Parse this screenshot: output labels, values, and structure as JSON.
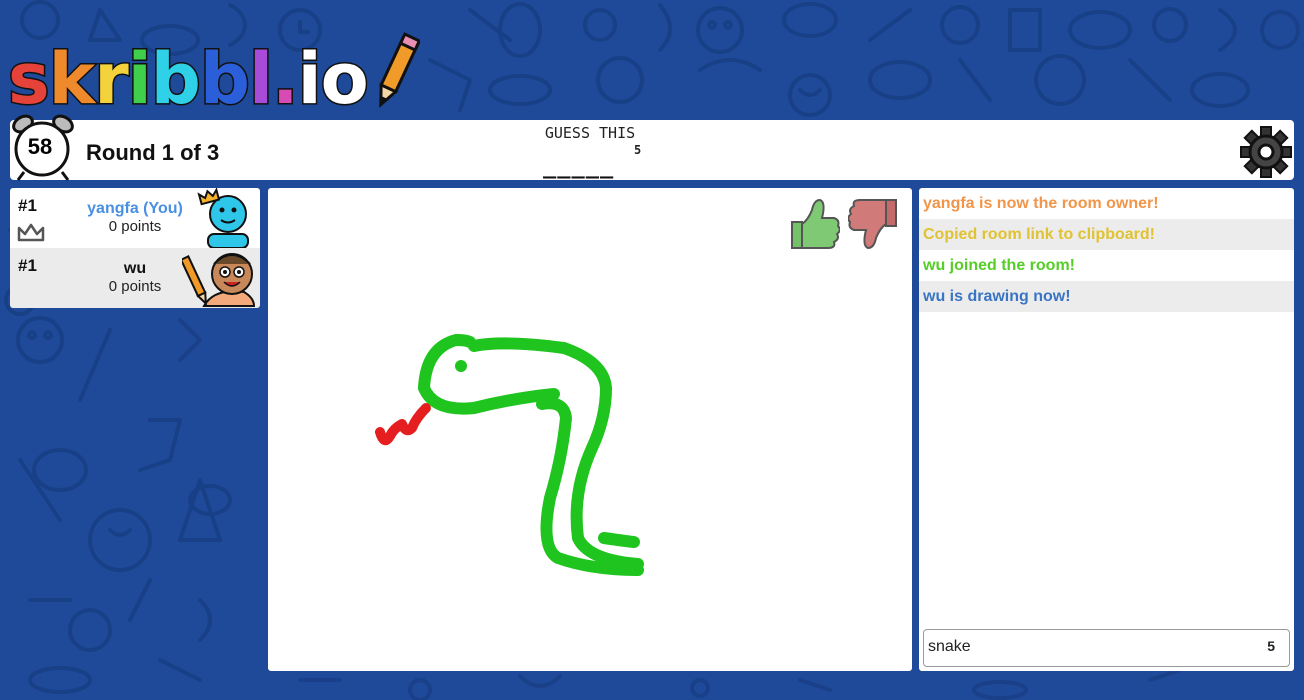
{
  "logo": {
    "letters": [
      {
        "char": "s",
        "color": "#e5433a"
      },
      {
        "char": "k",
        "color": "#ef8a2c"
      },
      {
        "char": "r",
        "color": "#f4d23b"
      },
      {
        "char": "i",
        "color": "#3fcf4a"
      },
      {
        "char": "b",
        "color": "#2ed1e8"
      },
      {
        "char": "b",
        "color": "#2b5fd9"
      },
      {
        "char": "l",
        "color": "#a84bd8"
      },
      {
        "char": ".",
        "color": "#d84bb5"
      },
      {
        "char": "i",
        "color": "#ffffff"
      },
      {
        "char": "o",
        "color": "#ffffff"
      }
    ],
    "icon": "pencil-icon"
  },
  "topbar": {
    "timer": "58",
    "round_text": "Round 1 of 3",
    "guess_label": "GUESS THIS",
    "word_length": "5",
    "word_blanks": "_____",
    "settings_icon": "gear-icon"
  },
  "players": [
    {
      "rank": "#1",
      "name": "yangfa (You)",
      "points": "0 points",
      "name_color": "#4a90e2",
      "avatar": "blue-avatar-with-crown",
      "badge": "crown-outline-icon"
    },
    {
      "rank": "#1",
      "name": "wu",
      "points": "0 points",
      "name_color": "#111111",
      "avatar": "drawing-avatar-with-pencil"
    }
  ],
  "canvas": {
    "like_icon": "thumbs-up-icon",
    "dislike_icon": "thumbs-down-icon",
    "drawing": "snake-drawing",
    "colors": {
      "body": "#1fc41f",
      "tongue": "#e51f1f"
    }
  },
  "chat": {
    "messages": [
      {
        "text": "yangfa is now the room owner!",
        "color": "#f0954a"
      },
      {
        "text": "Copied room link to clipboard!",
        "color": "#e0c232"
      },
      {
        "text": "wu joined the room!",
        "color": "#56ce27"
      },
      {
        "text": "wu is drawing now!",
        "color": "#3a75c4"
      }
    ],
    "input_value": "snake",
    "input_count": "5"
  }
}
